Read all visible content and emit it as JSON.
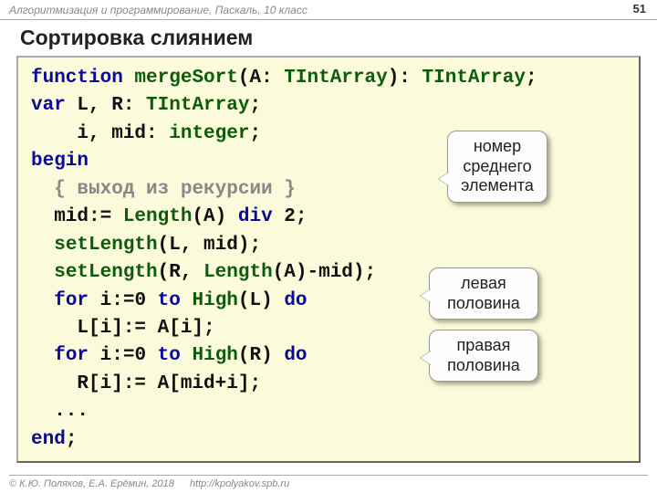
{
  "header": {
    "course": "Алгоритмизация и программирование, Паскаль, 10 класс",
    "page": "51"
  },
  "title": "Сортировка слиянием",
  "code": {
    "l1": {
      "kw1": "function",
      "fn": " mergeSort",
      "p1": "(A: ",
      "tp1": "TIntArray",
      "p2": "): ",
      "tp2": "TIntArray",
      "p3": ";"
    },
    "l2": {
      "kw1": "var",
      "t1": " L, R: ",
      "tp1": "TIntArray",
      "t2": ";"
    },
    "l3": {
      "t1": "    i, mid: ",
      "tp1": "integer",
      "t2": ";"
    },
    "l4": {
      "kw1": "begin"
    },
    "l5": {
      "t1": "  ",
      "cm": "{ выход из рекурсии }"
    },
    "l6": {
      "t1": "  mid:= ",
      "fn": "Length",
      "t2": "(A) ",
      "kw1": "div",
      "t3": " 2;"
    },
    "l7": {
      "t1": "  ",
      "fn": "setLength",
      "t2": "(L, mid);"
    },
    "l8": {
      "t1": "  ",
      "fn": "setLength",
      "t2": "(R, ",
      "fn2": "Length",
      "t3": "(A)-mid);"
    },
    "l9": {
      "t1": "  ",
      "kw1": "for",
      "t2": " i:=0 ",
      "kw2": "to",
      "t3": " ",
      "fn": "High",
      "t4": "(L) ",
      "kw3": "do"
    },
    "l10": {
      "t1": "    L[i]:= A[i];"
    },
    "l11": {
      "t1": "  ",
      "kw1": "for",
      "t2": " i:=0 ",
      "kw2": "to",
      "t3": " ",
      "fn": "High",
      "t4": "(R) ",
      "kw3": "do"
    },
    "l12": {
      "t1": "    R[i]:= A[mid+i];"
    },
    "l13": {
      "t1": "  ..."
    },
    "l14": {
      "kw1": "end",
      "t1": ";"
    }
  },
  "callouts": {
    "c1": "номер среднего элемента",
    "c2": "левая половина",
    "c3": "правая половина"
  },
  "footer": {
    "copyright": "© К.Ю. Поляков, Е.А. Ерёмин, 2018",
    "url": "http://kpolyakov.spb.ru"
  }
}
